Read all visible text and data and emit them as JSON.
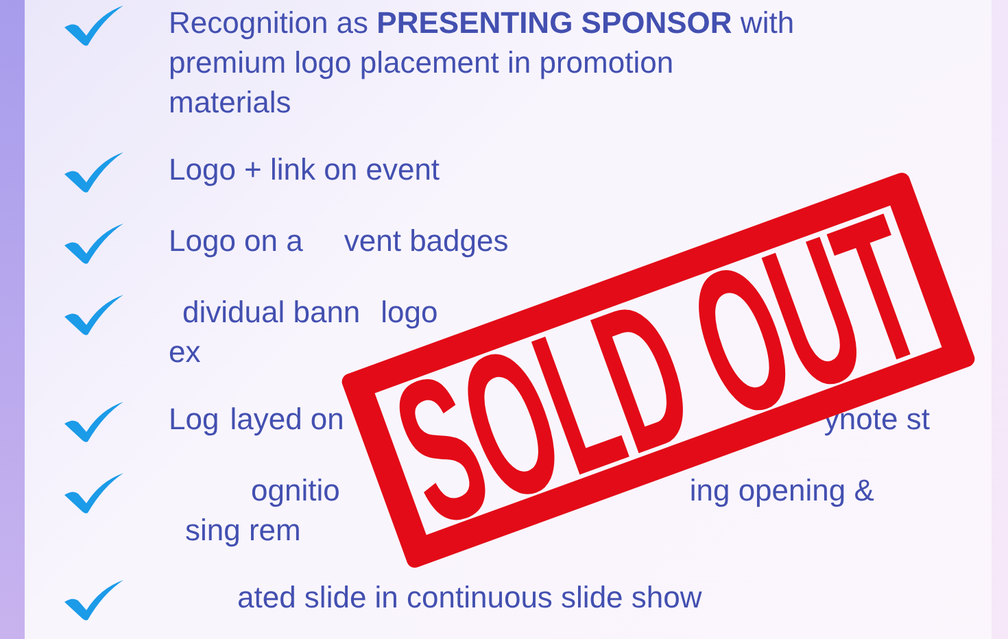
{
  "benefits": [
    {
      "lines": [
        [
          "Recognition as **PRESENTING SPONSOR** with"
        ],
        [
          "premium logo placement in promotion"
        ],
        [
          "materials"
        ]
      ]
    },
    {
      "lines": [
        [
          "Logo + link on event"
        ]
      ]
    },
    {
      "lines": [
        [
          "Logo on a",
          "vent badges"
        ]
      ]
    },
    {
      "lines": [
        [
          "dividual bann",
          "logo"
        ],
        [
          "ex"
        ]
      ]
    },
    {
      "lines": [
        [
          "Log",
          "layed on",
          "ynote st"
        ]
      ]
    },
    {
      "lines": [
        [
          "ognitio",
          "ing opening &"
        ],
        [
          "sing rem"
        ]
      ]
    },
    {
      "lines": [
        [
          "ated slide in continuous slide show"
        ]
      ]
    }
  ],
  "stamp": {
    "text": "SOLD OUT"
  }
}
